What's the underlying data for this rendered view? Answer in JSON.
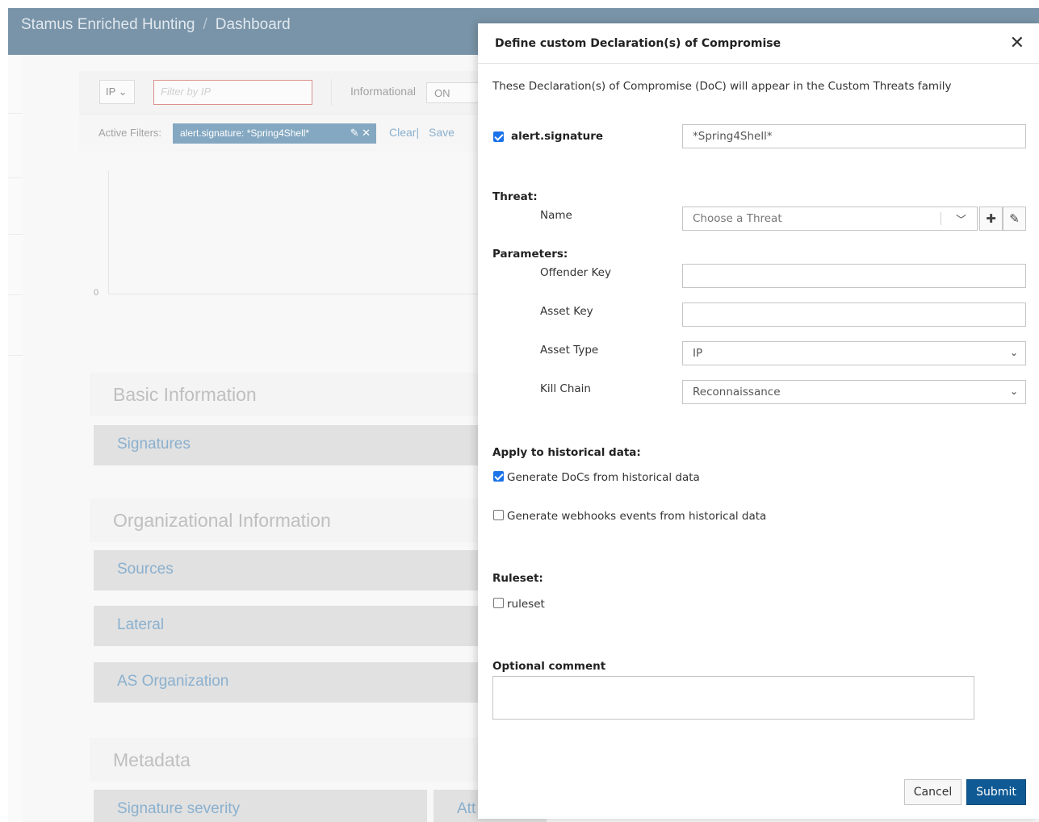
{
  "header": {
    "app_name": "Stamus Enriched Hunting",
    "separator": "/",
    "page": "Dashboard"
  },
  "filterbar": {
    "field_select": "IP ⌄",
    "filter_placeholder": "Filter by IP",
    "informational_label": "Informational",
    "informational_toggle": "ON"
  },
  "active_filters": {
    "label": "Active Filters:",
    "chip": "alert.signature: *Spring4Shell*",
    "clear": "Clear|",
    "save": "Save"
  },
  "chart": {
    "ytick": "0"
  },
  "sections": {
    "basic": "Basic Information",
    "signatures": "Signatures",
    "organizational": "Organizational Information",
    "sources": "Sources",
    "lateral": "Lateral",
    "as_org": "AS Organization",
    "metadata": "Metadata",
    "signature_severity": "Signature severity",
    "att": "Att"
  },
  "modal": {
    "title": "Define custom Declaration(s) of Compromise",
    "description": "These Declaration(s) of Compromise (DoC) will appear in the Custom Threats family",
    "signature_field": "alert.signature",
    "signature_value": "*Spring4Shell*",
    "threat_heading": "Threat:",
    "name_label": "Name",
    "threat_placeholder": "Choose a Threat",
    "parameters_heading": "Parameters:",
    "offender_key_label": "Offender Key",
    "asset_key_label": "Asset Key",
    "asset_type_label": "Asset Type",
    "asset_type_value": "IP",
    "kill_chain_label": "Kill Chain",
    "kill_chain_value": "Reconnaissance",
    "historical_heading": "Apply to historical data:",
    "gen_docs_label": "Generate DoCs from historical data",
    "gen_webhooks_label": "Generate webhooks events from historical data",
    "ruleset_heading": "Ruleset:",
    "ruleset_label": "ruleset",
    "comment_heading": "Optional comment",
    "cancel": "Cancel",
    "submit": "Submit"
  }
}
